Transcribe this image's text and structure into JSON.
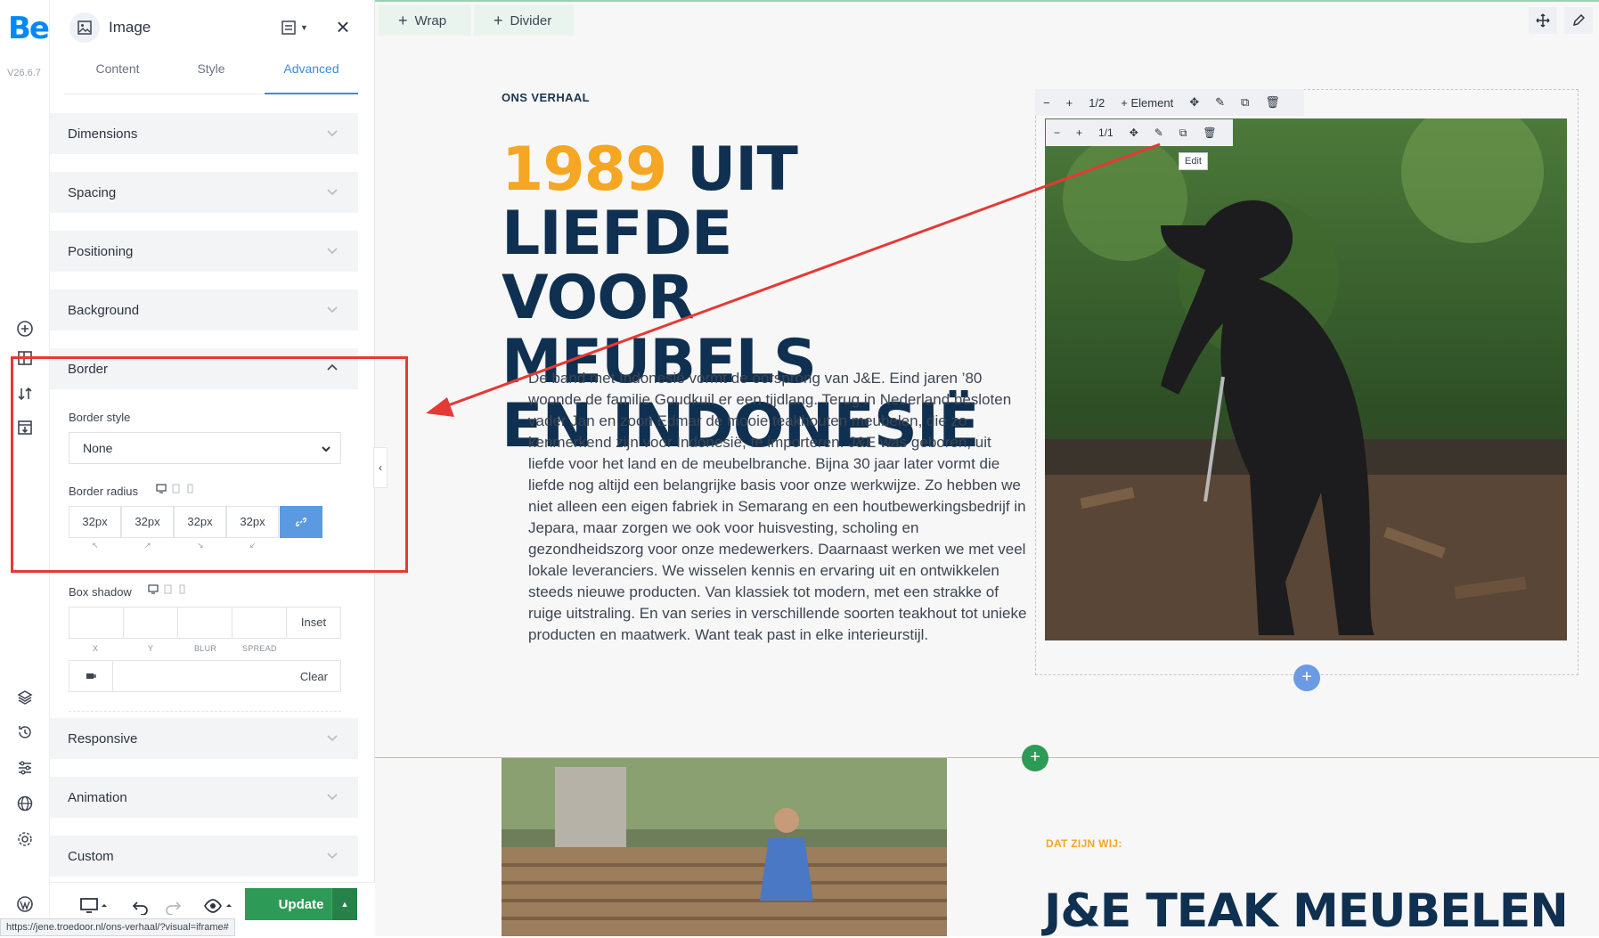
{
  "app": {
    "logo": "Be",
    "version": "V26.6.7"
  },
  "panel": {
    "title": "Image",
    "tabs": [
      {
        "label": "Content"
      },
      {
        "label": "Style"
      },
      {
        "label": "Advanced",
        "active": true
      }
    ],
    "sections": {
      "dimensions": "Dimensions",
      "spacing": "Spacing",
      "positioning": "Positioning",
      "background": "Background",
      "border": "Border",
      "responsive": "Responsive",
      "animation": "Animation",
      "custom": "Custom"
    },
    "border": {
      "style_label": "Border style",
      "style_value": "None",
      "radius_label": "Border radius",
      "radius_values": [
        "32px",
        "32px",
        "32px",
        "32px"
      ]
    },
    "box_shadow": {
      "label": "Box shadow",
      "inset_label": "Inset",
      "sublabels": [
        "X",
        "Y",
        "BLUR",
        "SPREAD"
      ],
      "clear_label": "Clear"
    },
    "update_label": "Update"
  },
  "canvas": {
    "wrap_label": "Wrap",
    "divider_label": "Divider",
    "eyebrow": "ONS VERHAAL",
    "headline_year": "1989",
    "headline_rest_line1": "UIT LIEFDE",
    "headline_line2": "VOOR MEUBELS",
    "headline_line3": "EN INDONESIË",
    "body": "De band met Indonesië vormt de oorsprong van J&E. Eind jaren ’80 woonde de familie Goudkuil er een tijdlang. Terug in Nederland besloten vader Jan en zoon Edmar de mooie teakhouten meubelen, die zo kenmerkend zijn voor Indonesië, te importeren. J&E was geboren, uit liefde voor het land en de meubelbranche. Bijna 30 jaar later vormt die liefde nog altijd een belangrijke basis voor onze werkwijze. Zo hebben we niet alleen een eigen fabriek in Semarang en een houtbewerkingsbedrijf in Jepara, maar zorgen we ook voor huisvesting, scholing en gezondheidszorg voor onze medewerkers. Daarnaast werken we met veel lokale leveranciers. We wisselen kennis en ervaring uit en ontwikkelen steeds nieuwe producten. Van klassiek tot modern, met een strakke of ruige uitstraling. En van series in verschillende soorten teakhout tot unieke producten en maatwerk. Want teak past in elke interieurstijl.",
    "toolbar1": {
      "fraction": "1/2",
      "element_label": "Element"
    },
    "toolbar2": {
      "fraction": "1/1"
    },
    "edit_tooltip": "Edit",
    "eyebrow2": "DAT ZIJN WIJ:",
    "headline2": "J&E TEAK MEUBELEN"
  },
  "status_url": "https://jene.troedoor.nl/ons-verhaal/?visual=iframe#",
  "colors": {
    "accent_green": "#2e9a57",
    "accent_blue": "#3d8bd8",
    "headline_navy": "#0f3050",
    "year_orange": "#f5a623",
    "annotation_red": "#e53935"
  }
}
